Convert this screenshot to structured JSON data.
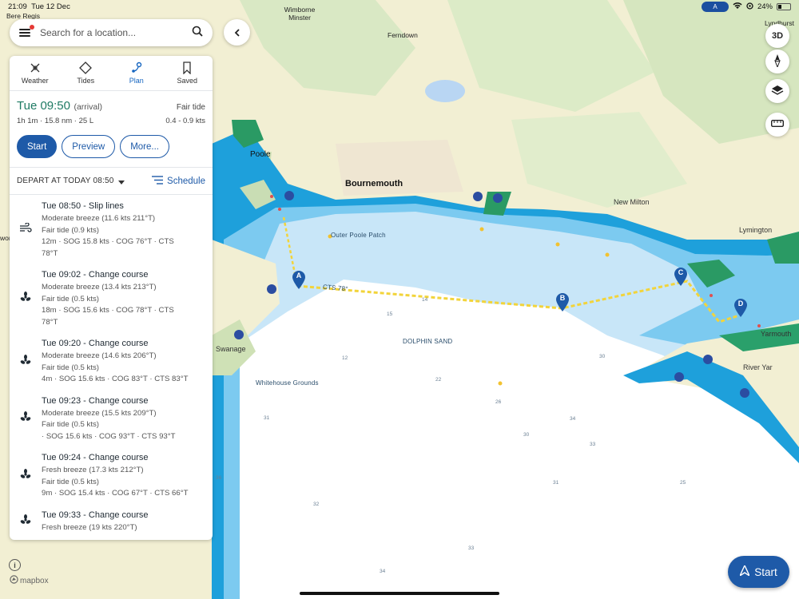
{
  "status_bar": {
    "time": "21:09",
    "date": "Tue 12 Dec",
    "nav_pill": "A",
    "battery": "24%"
  },
  "search": {
    "placeholder": "Search for a location..."
  },
  "tabs": [
    {
      "label": "Weather",
      "icon": "weather-icon"
    },
    {
      "label": "Tides",
      "icon": "tides-icon"
    },
    {
      "label": "Plan",
      "icon": "plan-icon",
      "active": true
    },
    {
      "label": "Saved",
      "icon": "bookmark-icon"
    }
  ],
  "summary": {
    "arrival_time": "Tue 09:50",
    "arrival_note": "(arrival)",
    "tide": "Fair tide",
    "details": "1h 1m · 15.8 nm · 25 L",
    "tide_range": "0.4 - 0.9 kts"
  },
  "buttons": {
    "start": "Start",
    "preview": "Preview",
    "more": "More..."
  },
  "depart": {
    "label": "DEPART AT TODAY 08:50",
    "schedule": "Schedule"
  },
  "steps": [
    {
      "icon": "wind-icon",
      "title": "Tue 08:50 - Slip lines",
      "lines": [
        "Moderate breeze (11.6 kts 211°T)",
        "Fair tide (0.9 kts)",
        "12m · SOG 15.8 kts · COG 76°T · CTS",
        "78°T"
      ]
    },
    {
      "icon": "propeller-icon",
      "title": "Tue 09:02 - Change course",
      "lines": [
        "Moderate breeze (13.4 kts 213°T)",
        "Fair tide (0.5 kts)",
        "18m · SOG 15.6 kts · COG 78°T · CTS",
        "78°T"
      ]
    },
    {
      "icon": "propeller-icon",
      "title": "Tue 09:20 - Change course",
      "lines": [
        "Moderate breeze (14.6 kts 206°T)",
        "Fair tide (0.5 kts)",
        "4m · SOG 15.6 kts · COG 83°T · CTS 83°T"
      ]
    },
    {
      "icon": "propeller-icon",
      "title": "Tue 09:23 - Change course",
      "lines": [
        "Moderate breeze (15.5 kts 209°T)",
        "Fair tide (0.5 kts)",
        " · SOG 15.6 kts · COG 93°T · CTS 93°T"
      ]
    },
    {
      "icon": "propeller-icon",
      "title": "Tue 09:24 - Change course",
      "lines": [
        "Fresh breeze (17.3 kts 212°T)",
        "Fair tide (0.5 kts)",
        "9m · SOG 15.4 kts · COG 67°T · CTS 66°T"
      ]
    },
    {
      "icon": "propeller-icon",
      "title": "Tue 09:33 - Change course",
      "lines": [
        "Fresh breeze (19 kts 220°T)"
      ]
    }
  ],
  "map": {
    "places": [
      "Bere Regis",
      "Wimborne Minster",
      "Ferndown",
      "Poole",
      "Bournemouth",
      "New Milton",
      "Lymington",
      "Lyndhurst",
      "Swanage",
      "Yarmouth",
      "River Yar",
      "wor"
    ],
    "sea_labels": [
      "Outer Poole Patch",
      "DOLPHIN SAND",
      "Whitehouse Grounds"
    ],
    "waypoints": [
      "A",
      "B",
      "C",
      "D"
    ],
    "route_label": "CTS 78°"
  },
  "controls": {
    "btn_3d": "3D",
    "start_fab": "Start",
    "attribution": "mapbox"
  },
  "colors": {
    "accent": "#1e5aa8",
    "arrival": "#1e7a63",
    "route": "#f2d43b",
    "deep_sea": "#ffffff",
    "shallow_sea": "#22a3dd"
  }
}
